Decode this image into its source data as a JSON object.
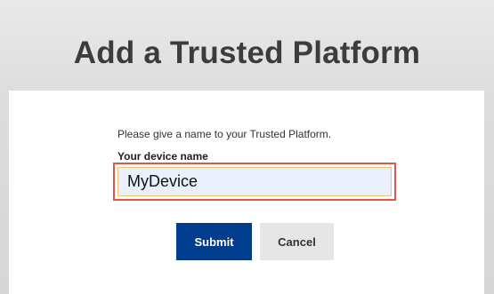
{
  "header": {
    "title": "Add a Trusted Platform"
  },
  "form": {
    "instruction": "Please give a name to your Trusted Platform.",
    "device_name_label": "Your device name",
    "device_name_value": "MyDevice",
    "submit_label": "Submit",
    "cancel_label": "Cancel"
  },
  "colors": {
    "primary_button": "#003d8f",
    "secondary_button": "#e6e6e6",
    "highlight_border": "#e5534b",
    "input_background": "#eaf0fb"
  }
}
